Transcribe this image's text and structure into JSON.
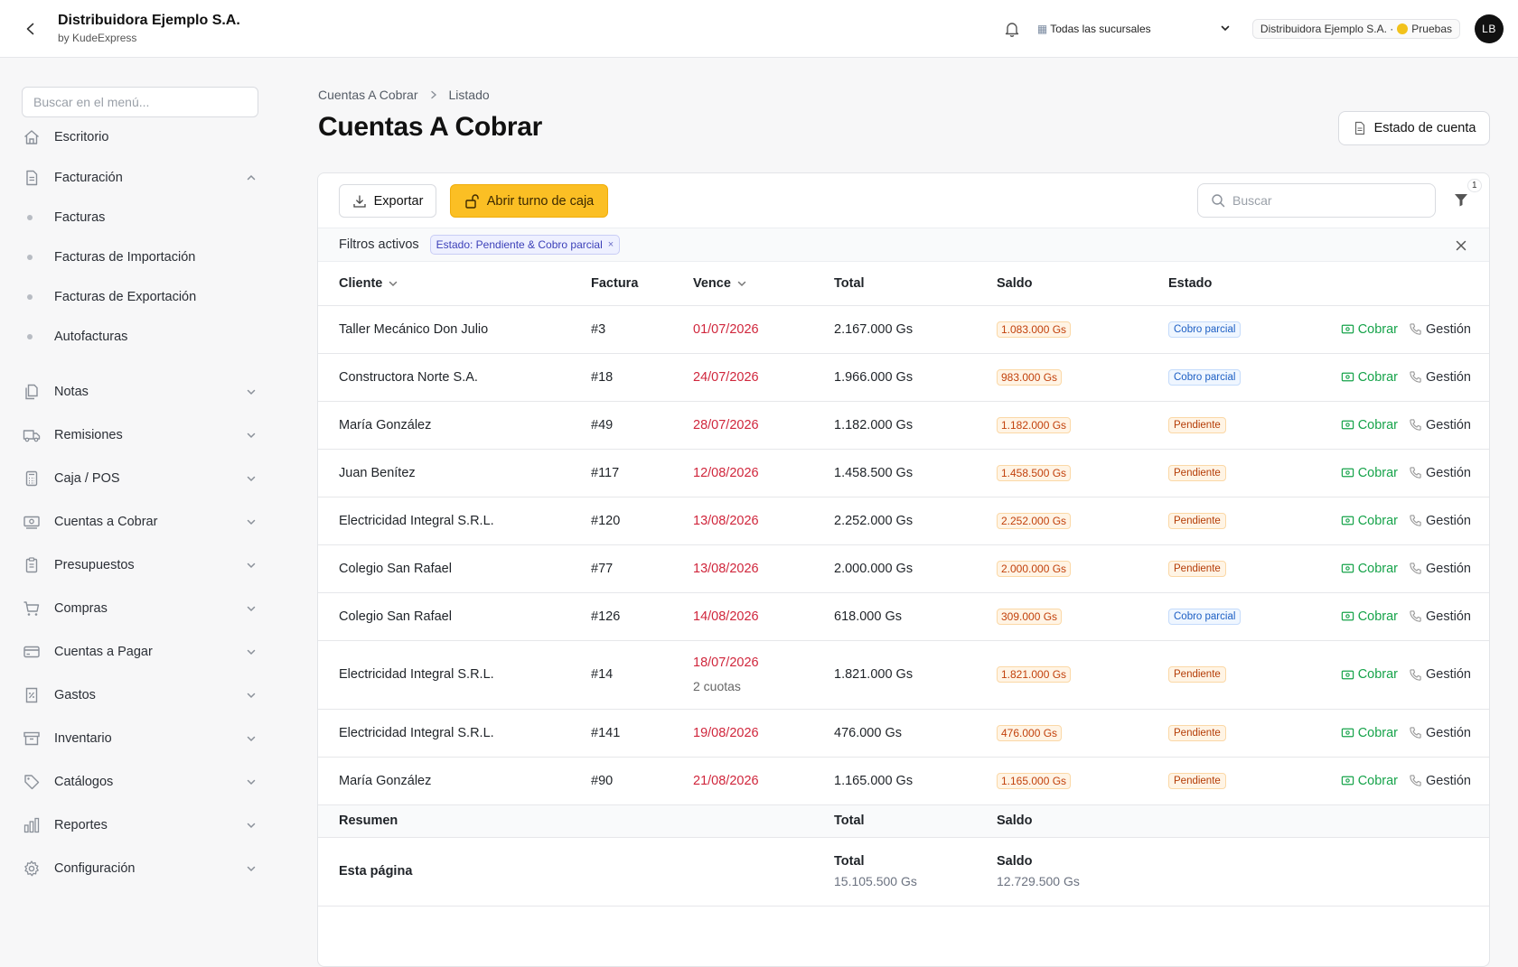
{
  "header": {
    "company": "Distribuidora Ejemplo S.A.",
    "by": "by KudeExpress",
    "branch_selector": "Todas las sucursales",
    "company_pill_name": "Distribuidora Ejemplo S.A. ·",
    "company_pill_env": "Pruebas",
    "avatar_initials": "LB"
  },
  "sidebar": {
    "search_placeholder": "Buscar en el menú...",
    "escritorio": "Escritorio",
    "facturacion": "Facturación",
    "sub": [
      "Facturas",
      "Facturas de Importación",
      "Facturas de Exportación",
      "Autofacturas"
    ],
    "items": [
      {
        "label": "Notas",
        "icon": "notes-icon"
      },
      {
        "label": "Remisiones",
        "icon": "truck-icon"
      },
      {
        "label": "Caja / POS",
        "icon": "calculator-icon"
      },
      {
        "label": "Cuentas a Cobrar",
        "icon": "cash-icon"
      },
      {
        "label": "Presupuestos",
        "icon": "clipboard-icon"
      },
      {
        "label": "Compras",
        "icon": "cart-icon"
      },
      {
        "label": "Cuentas a Pagar",
        "icon": "credit-card-icon"
      },
      {
        "label": "Gastos",
        "icon": "receipt-icon"
      },
      {
        "label": "Inventario",
        "icon": "archive-icon"
      },
      {
        "label": "Catálogos",
        "icon": "tag-icon"
      },
      {
        "label": "Reportes",
        "icon": "bar-chart-icon"
      },
      {
        "label": "Configuración",
        "icon": "gear-icon"
      }
    ]
  },
  "page": {
    "breadcrumb": [
      "Cuentas A Cobrar",
      "Listado"
    ],
    "title": "Cuentas A Cobrar",
    "estado_btn": "Estado de cuenta"
  },
  "toolbar": {
    "export": "Exportar",
    "open_register": "Abrir turno de caja",
    "search_placeholder": "Buscar",
    "filter_count": "1"
  },
  "filters": {
    "label": "Filtros activos",
    "chip": "Estado: Pendiente & Cobro parcial",
    "chip_close": "×"
  },
  "table": {
    "headers": {
      "cliente": "Cliente",
      "factura": "Factura",
      "vence": "Vence",
      "total": "Total",
      "saldo": "Saldo",
      "estado": "Estado"
    },
    "action_cobrar": "Cobrar",
    "action_gestion": "Gestión",
    "rows": [
      {
        "cliente": "Taller Mecánico Don Julio",
        "factura": "#3",
        "vence": "01/07/2026",
        "vence_sub": "",
        "total": "2.167.000 Gs",
        "saldo": "1.083.000 Gs",
        "estado": "Cobro parcial",
        "kind": "parcial"
      },
      {
        "cliente": "Constructora Norte S.A.",
        "factura": "#18",
        "vence": "24/07/2026",
        "vence_sub": "",
        "total": "1.966.000 Gs",
        "saldo": "983.000 Gs",
        "estado": "Cobro parcial",
        "kind": "parcial"
      },
      {
        "cliente": "María González",
        "factura": "#49",
        "vence": "28/07/2026",
        "vence_sub": "",
        "total": "1.182.000 Gs",
        "saldo": "1.182.000 Gs",
        "estado": "Pendiente",
        "kind": "pend"
      },
      {
        "cliente": "Juan Benítez",
        "factura": "#117",
        "vence": "12/08/2026",
        "vence_sub": "",
        "total": "1.458.500 Gs",
        "saldo": "1.458.500 Gs",
        "estado": "Pendiente",
        "kind": "pend"
      },
      {
        "cliente": "Electricidad Integral S.R.L.",
        "factura": "#120",
        "vence": "13/08/2026",
        "vence_sub": "",
        "total": "2.252.000 Gs",
        "saldo": "2.252.000 Gs",
        "estado": "Pendiente",
        "kind": "pend"
      },
      {
        "cliente": "Colegio San Rafael",
        "factura": "#77",
        "vence": "13/08/2026",
        "vence_sub": "",
        "total": "2.000.000 Gs",
        "saldo": "2.000.000 Gs",
        "estado": "Pendiente",
        "kind": "pend"
      },
      {
        "cliente": "Colegio San Rafael",
        "factura": "#126",
        "vence": "14/08/2026",
        "vence_sub": "",
        "total": "618.000 Gs",
        "saldo": "309.000 Gs",
        "estado": "Cobro parcial",
        "kind": "parcial"
      },
      {
        "cliente": "Electricidad Integral S.R.L.",
        "factura": "#14",
        "vence": "18/07/2026",
        "vence_sub": "2 cuotas",
        "total": "1.821.000 Gs",
        "saldo": "1.821.000 Gs",
        "estado": "Pendiente",
        "kind": "pend"
      },
      {
        "cliente": "Electricidad Integral S.R.L.",
        "factura": "#141",
        "vence": "19/08/2026",
        "vence_sub": "",
        "total": "476.000 Gs",
        "saldo": "476.000 Gs",
        "estado": "Pendiente",
        "kind": "pend"
      },
      {
        "cliente": "María González",
        "factura": "#90",
        "vence": "21/08/2026",
        "vence_sub": "",
        "total": "1.165.000 Gs",
        "saldo": "1.165.000 Gs",
        "estado": "Pendiente",
        "kind": "pend"
      }
    ]
  },
  "summary": {
    "head": "Resumen",
    "head_total": "Total",
    "head_saldo": "Saldo",
    "page_label": "Esta página",
    "total_label": "Total",
    "total_value": "15.105.500 Gs",
    "saldo_label": "Saldo",
    "saldo_value": "12.729.500 Gs"
  },
  "colors": {
    "accent": "#fbbf24",
    "overdue": "#d0263c",
    "cobrar": "#16a34a"
  }
}
